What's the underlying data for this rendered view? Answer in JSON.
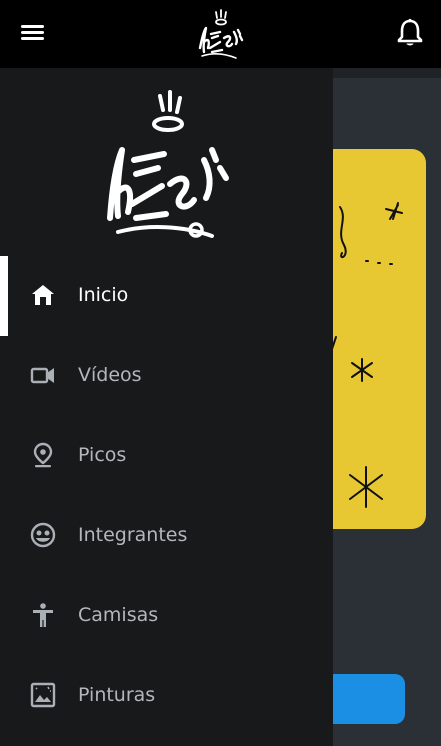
{
  "app_bar": {
    "menu_icon": "hamburger-menu-icon",
    "logo": "crew-tag-logo",
    "notifications_icon": "bell-icon"
  },
  "drawer": {
    "logo": "crew-tag-logo",
    "items": [
      {
        "label": "Inicio",
        "icon": "home-icon",
        "active": true
      },
      {
        "label": "Vídeos",
        "icon": "video-camera-icon",
        "active": false
      },
      {
        "label": "Picos",
        "icon": "location-pin-icon",
        "active": false
      },
      {
        "label": "Integrantes",
        "icon": "face-icon",
        "active": false
      },
      {
        "label": "Camisas",
        "icon": "person-icon",
        "active": false
      },
      {
        "label": "Pinturas",
        "icon": "image-frame-icon",
        "active": false
      }
    ]
  },
  "colors": {
    "app_bar": "#000000",
    "drawer": "#17191b",
    "content_background": "#2b3036",
    "hero_card": "#e8c832",
    "cta_button": "#1a8fe3",
    "active_marker": "#ffffff",
    "inactive_label": "#b2b7bc"
  }
}
